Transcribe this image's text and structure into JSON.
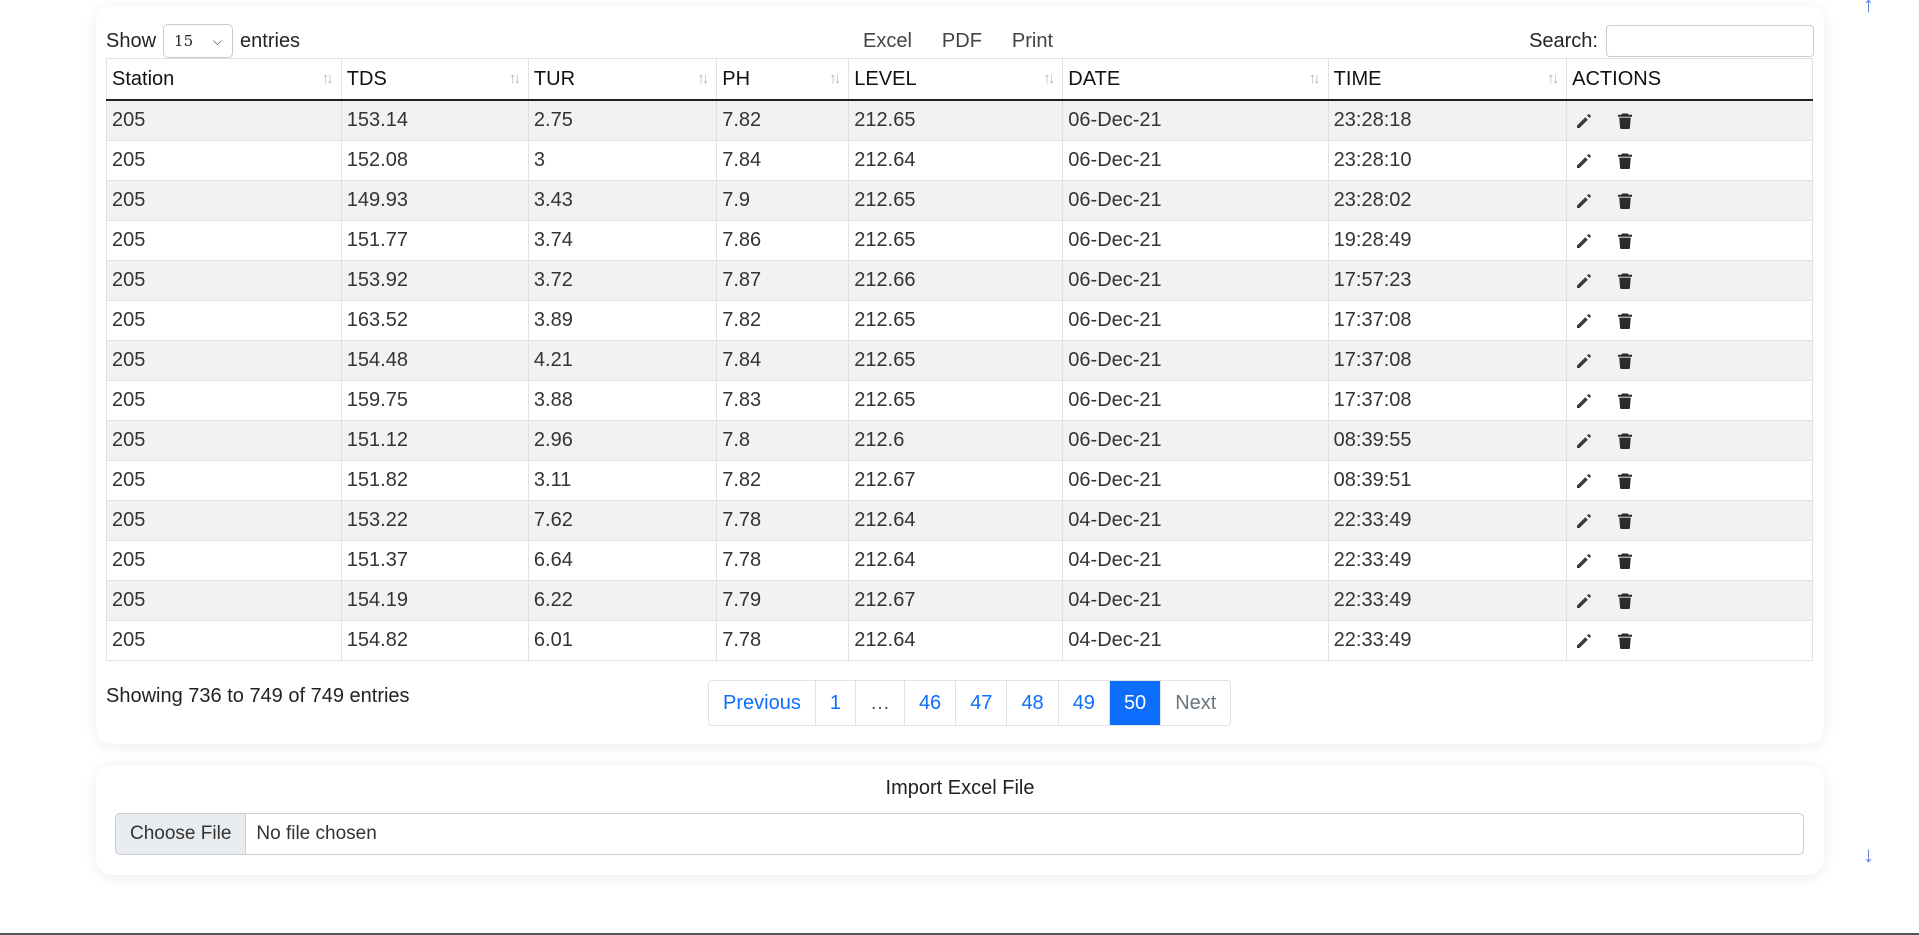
{
  "length_menu": {
    "show_label": "Show",
    "value": "15",
    "entries_label": "entries"
  },
  "export_buttons": {
    "excel": "Excel",
    "pdf": "PDF",
    "print": "Print"
  },
  "search": {
    "label": "Search:",
    "value": ""
  },
  "table": {
    "columns": [
      "Station",
      "TDS",
      "TUR",
      "PH",
      "LEVEL",
      "DATE",
      "TIME",
      "ACTIONS"
    ],
    "rows": [
      [
        "205",
        "153.14",
        "2.75",
        "7.82",
        "212.65",
        "06-Dec-21",
        "23:28:18"
      ],
      [
        "205",
        "152.08",
        "3",
        "7.84",
        "212.64",
        "06-Dec-21",
        "23:28:10"
      ],
      [
        "205",
        "149.93",
        "3.43",
        "7.9",
        "212.65",
        "06-Dec-21",
        "23:28:02"
      ],
      [
        "205",
        "151.77",
        "3.74",
        "7.86",
        "212.65",
        "06-Dec-21",
        "19:28:49"
      ],
      [
        "205",
        "153.92",
        "3.72",
        "7.87",
        "212.66",
        "06-Dec-21",
        "17:57:23"
      ],
      [
        "205",
        "163.52",
        "3.89",
        "7.82",
        "212.65",
        "06-Dec-21",
        "17:37:08"
      ],
      [
        "205",
        "154.48",
        "4.21",
        "7.84",
        "212.65",
        "06-Dec-21",
        "17:37:08"
      ],
      [
        "205",
        "159.75",
        "3.88",
        "7.83",
        "212.65",
        "06-Dec-21",
        "17:37:08"
      ],
      [
        "205",
        "151.12",
        "2.96",
        "7.8",
        "212.6",
        "06-Dec-21",
        "08:39:55"
      ],
      [
        "205",
        "151.82",
        "3.11",
        "7.82",
        "212.67",
        "06-Dec-21",
        "08:39:51"
      ],
      [
        "205",
        "153.22",
        "7.62",
        "7.78",
        "212.64",
        "04-Dec-21",
        "22:33:49"
      ],
      [
        "205",
        "151.37",
        "6.64",
        "7.78",
        "212.64",
        "04-Dec-21",
        "22:33:49"
      ],
      [
        "205",
        "154.19",
        "6.22",
        "7.79",
        "212.67",
        "04-Dec-21",
        "22:33:49"
      ],
      [
        "205",
        "154.82",
        "6.01",
        "7.78",
        "212.64",
        "04-Dec-21",
        "22:33:49"
      ]
    ],
    "row_actions": [
      "pencil-icon",
      "trash-icon"
    ]
  },
  "info": "Showing 736 to 749 of 749 entries",
  "pagination": {
    "previous": "Previous",
    "pages": [
      "1",
      "…",
      "46",
      "47",
      "48",
      "49",
      "50"
    ],
    "current": "50",
    "next": "Next"
  },
  "import": {
    "title": "Import Excel File",
    "choose_label": "Choose File",
    "status": "No file chosen"
  },
  "scroll_arrows": {
    "up": "↑",
    "down": "↓"
  },
  "colors": {
    "accent": "#0d6efd",
    "arrow": "#5b7ee5",
    "stripe": "#f2f2f2"
  }
}
